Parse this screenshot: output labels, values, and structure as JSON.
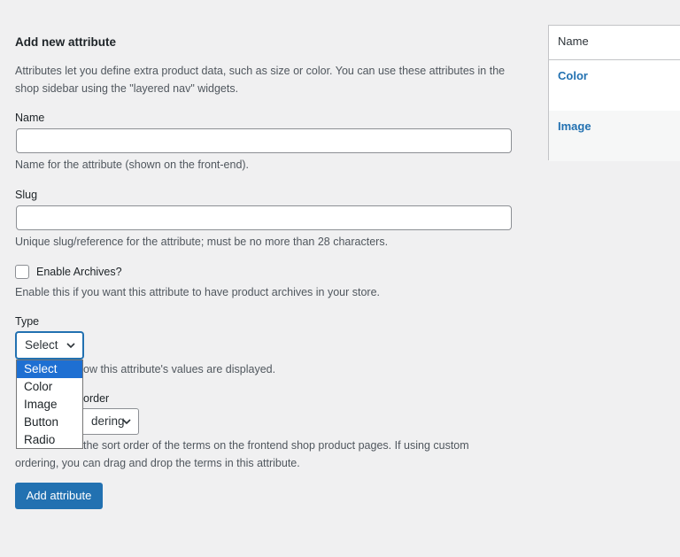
{
  "form": {
    "heading": "Add new attribute",
    "intro_line1": "Attributes let you define extra product data, such as size or color. You can use these attributes in the",
    "intro_line2": "shop sidebar using the \"layered nav\" widgets.",
    "name": {
      "label": "Name",
      "value": "",
      "help": "Name for the attribute (shown on the front-end)."
    },
    "slug": {
      "label": "Slug",
      "value": "",
      "help": "Unique slug/reference for the attribute; must be no more than 28 characters."
    },
    "archives": {
      "label": "Enable Archives?",
      "checked": false,
      "help": "Enable this if you want this attribute to have product archives in your store."
    },
    "type": {
      "label": "Type",
      "selected": "Select",
      "help_visible": "ow this attribute's values are displayed.",
      "options": [
        "Select",
        "Color",
        "Image",
        "Button",
        "Radio"
      ]
    },
    "order": {
      "label_visible": "order",
      "selected_visible": "dering",
      "help_line1_visible": "the sort order of the terms on the frontend shop product pages. If using custom",
      "help_line2": "ordering, you can drag and drop the terms in this attribute."
    },
    "submit_label": "Add attribute"
  },
  "attributes_table": {
    "header": "Name",
    "rows": [
      {
        "name": "Color"
      },
      {
        "name": "Image"
      }
    ]
  },
  "colors": {
    "accent": "#2271b1",
    "background": "#f0f0f1",
    "dropdown_highlight": "#1e6fd2"
  }
}
